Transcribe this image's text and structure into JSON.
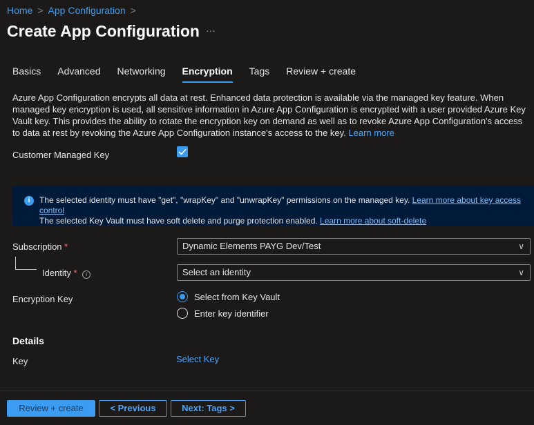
{
  "breadcrumb": [
    "Home",
    "App Configuration"
  ],
  "title": "Create App Configuration",
  "more": "···",
  "tabs": [
    {
      "label": "Basics"
    },
    {
      "label": "Advanced"
    },
    {
      "label": "Networking"
    },
    {
      "label": "Encryption",
      "active": true
    },
    {
      "label": "Tags"
    },
    {
      "label": "Review + create"
    }
  ],
  "description": "Azure App Configuration encrypts all data at rest. Enhanced data protection is available via the managed key feature. When managed key encryption is used, all sensitive information in Azure App Configuration is encrypted with a user provided Azure Key Vault key. This provides the ability to rotate the encryption key on demand as well as to revoke Azure App Configuration's access to data at rest by revoking the Azure App Configuration instance's access to the key.",
  "learn_more": "Learn more",
  "cmk": {
    "label": "Customer Managed Key",
    "checked": true
  },
  "info": {
    "line1": "The selected identity must have \"get\", \"wrapKey\" and \"unwrapKey\" permissions on the managed key.",
    "link1": "Learn more about key access control",
    "line2": "The selected Key Vault must have soft delete and purge protection enabled.",
    "link2": "Learn more about soft-delete"
  },
  "subscription": {
    "label": "Subscription",
    "value": "Dynamic Elements PAYG Dev/Test"
  },
  "identity": {
    "label": "Identity",
    "value": "Select an identity"
  },
  "encryption_key": {
    "label": "Encryption Key",
    "options": [
      "Select from Key Vault",
      "Enter key identifier"
    ],
    "selected": 0
  },
  "details": {
    "heading": "Details",
    "key_label": "Key",
    "key_link": "Select Key"
  },
  "buttons": {
    "review": "Review + create",
    "previous": "< Previous",
    "next": "Next: Tags >"
  },
  "colors": {
    "accent": "#3b9cf2",
    "background": "#1b1a19",
    "info_bg": "#001a3a"
  }
}
